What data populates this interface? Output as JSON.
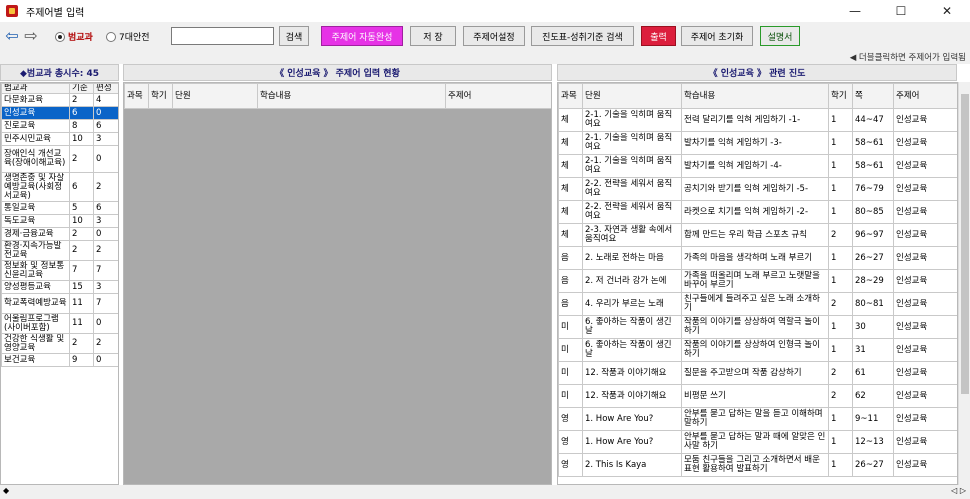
{
  "window": {
    "title": "주제어별 입력",
    "minimize": "—",
    "maximize": "☐",
    "close": "✕"
  },
  "toolbar": {
    "back_glyph": "⇦",
    "forward_glyph": "⇨",
    "radio1": "범교과",
    "radio2": "7대안전",
    "search_value": "",
    "buttons": [
      "검색",
      "주제어 자동완성",
      "저 장",
      "주제어설정",
      "진도표-성취기준 검색",
      "출력",
      "주제어 초기화",
      "설명서"
    ]
  },
  "hint": "◀ 더블클릭하면 주제어가 입력됨",
  "left": {
    "title": "◆범교과 총시수: 45",
    "headers": [
      "범교과",
      "기준",
      "편성"
    ],
    "rows": [
      [
        "다문화교육",
        "2",
        "4"
      ],
      [
        "인성교육",
        "6",
        "0"
      ],
      [
        "진로교육",
        "8",
        "6"
      ],
      [
        "민주시민교육",
        "10",
        "3"
      ],
      [
        "장애인식 개선교육(장애이해교육)",
        "2",
        "0"
      ],
      [
        "생명존중 및 자살예방교육(사회정서교육)",
        "6",
        "2"
      ],
      [
        "통일교육",
        "5",
        "6"
      ],
      [
        "독도교육",
        "10",
        "3"
      ],
      [
        "경제·금융교육",
        "2",
        "0"
      ],
      [
        "환경·지속가능발전교육",
        "2",
        "2"
      ],
      [
        "정보화 및 정보통신윤리교육",
        "7",
        "7"
      ],
      [
        "양성평등교육",
        "15",
        "3"
      ],
      [
        "학교폭력예방교육",
        "11",
        "7"
      ],
      [
        "어울림프로그램(사이버포함)",
        "11",
        "0"
      ],
      [
        "건강한 식생활 및 영양교육",
        "2",
        "2"
      ],
      [
        "보건교육",
        "9",
        "0"
      ]
    ]
  },
  "middle": {
    "title": "《 인성교육 》 주제어 입력 현황",
    "headers": [
      "과목",
      "학기",
      "단원",
      "학습내용",
      "주제어"
    ]
  },
  "right": {
    "title": "《 인성교육 》 관련 진도",
    "headers": [
      "과목",
      "단원",
      "학습내용",
      "학기",
      "쪽",
      "주제어"
    ],
    "rows": [
      [
        "체",
        "2-1. 기술을 익히며 움직여요",
        "전력 달리기를 익혀 게임하기 -1-",
        "1",
        "44~47",
        "인성교육"
      ],
      [
        "체",
        "2-1. 기술을 익히며 움직여요",
        "발차기를 익혀 게임하기 -3-",
        "1",
        "58~61",
        "인성교육"
      ],
      [
        "체",
        "2-1. 기술을 익히며 움직여요",
        "발차기를 익혀 게임하기 -4-",
        "1",
        "58~61",
        "인성교육"
      ],
      [
        "체",
        "2-2. 전략을 세워서 움직여요",
        "공치기와 받기를 익혀 게임하기 -5-",
        "1",
        "76~79",
        "인성교육"
      ],
      [
        "체",
        "2-2. 전략을 세워서 움직여요",
        "라켓으로 치기를 익혀 게임하기 -2-",
        "1",
        "80~85",
        "인성교육"
      ],
      [
        "체",
        "2-3. 자연과 생활 속에서 움직여요",
        "함께 만드는 우리 학급 스포츠 규칙",
        "2",
        "96~97",
        "인성교육"
      ],
      [
        "음",
        "2. 노래로 전하는 마음",
        "가족의 마음을 생각하며 노래 부르기",
        "1",
        "26~27",
        "인성교육"
      ],
      [
        "음",
        "2. 저 건너라 강가 논에",
        "가족을 떠올리며 노래 부르고 노랫말을 바꾸어 부르기",
        "1",
        "28~29",
        "인성교육"
      ],
      [
        "음",
        "4. 우리가 부르는 노래",
        "친구들에게 들려주고 싶은 노래 소개하기",
        "2",
        "80~81",
        "인성교육"
      ],
      [
        "미",
        "6. 좋아하는 작품이 생긴 날",
        "작품의 이야기를 상상하여 역할극 놀이하기",
        "1",
        "30",
        "인성교육"
      ],
      [
        "미",
        "6. 좋아하는 작품이 생긴 날",
        "작품의 이야기를 상상하여 인형극 놀이하기",
        "1",
        "31",
        "인성교육"
      ],
      [
        "미",
        "12. 작품과 이야기해요",
        "질문을 주고받으며 작품 감상하기",
        "2",
        "61",
        "인성교육"
      ],
      [
        "미",
        "12. 작품과 이야기해요",
        "비평문 쓰기",
        "2",
        "62",
        "인성교육"
      ],
      [
        "영",
        "1. How Are You?",
        "안부를 묻고 답하는 말을 듣고 이해하며 말하기",
        "1",
        "9~11",
        "인성교육"
      ],
      [
        "영",
        "1. How Are You?",
        "안부를 묻고 답하는 말과 때에 알맞은 인사말 하기",
        "1",
        "12~13",
        "인성교육"
      ],
      [
        "영",
        "2. This Is Kaya",
        "모둠 친구들을 그리고 소개하면서 배운 표현 활용하여 발표하기",
        "1",
        "26~27",
        "인성교육"
      ]
    ]
  },
  "status": {
    "left": "◆",
    "right": "◁ ▷"
  }
}
